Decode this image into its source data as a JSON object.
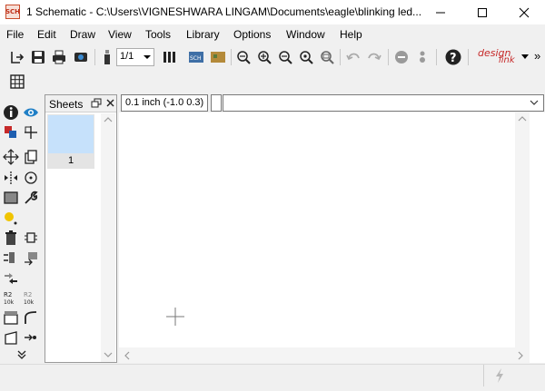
{
  "window": {
    "app_icon_text": "SCH",
    "title": "1 Schematic - C:\\Users\\VIGNESHWARA LINGAM\\Documents\\eagle\\blinking led..."
  },
  "menu": {
    "items": [
      "File",
      "Edit",
      "Draw",
      "View",
      "Tools",
      "Library",
      "Options",
      "Window",
      "Help"
    ]
  },
  "toolbar": {
    "sheet_select_value": "1/1",
    "brand_line1": "design",
    "brand_line2": "link",
    "overflow": "»"
  },
  "command_bar": {
    "grid_coordinate": "0.1 inch (-1.0 0.3)",
    "command_input_value": ""
  },
  "sheets_panel": {
    "title": "Sheets",
    "sheets": [
      {
        "label": "1",
        "selected": true
      }
    ]
  },
  "colors": {
    "titlebar_bg": "#ffffff",
    "chrome_bg": "#f0f0f0",
    "canvas_bg": "#ffffff",
    "sheet_thumb_selected": "#c6e1fb",
    "brand_red": "#c62a2a",
    "accent_blue": "#1f7fc6"
  }
}
